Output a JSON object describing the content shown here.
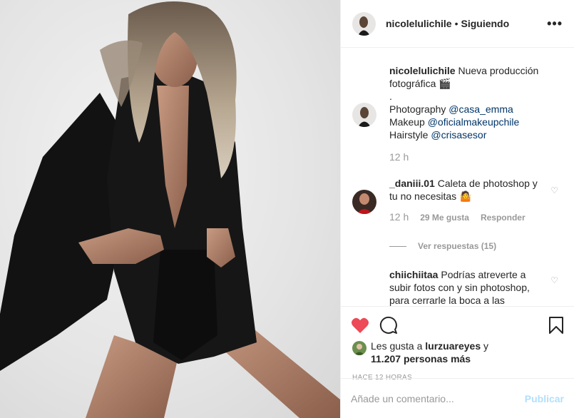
{
  "header": {
    "username": "nicolelulichile",
    "separator": "•",
    "follow_status": "Siguiendo",
    "more_icon": "more-horizontal-icon"
  },
  "comments": [
    {
      "username": "nicolelulichile",
      "text_1": " Nueva producción fotográfica 🎬",
      "text_2": ".",
      "lines": [
        {
          "label": "Photography ",
          "mention": "@casa_emma"
        },
        {
          "label": "Makeup ",
          "mention": "@oficialmakeupchile"
        },
        {
          "label": "Hairstyle ",
          "mention": "@crisasesor"
        }
      ],
      "time": "12 h"
    },
    {
      "username": "_daniii.01",
      "text": " Caleta de photoshop y tu no necesitas 🤷",
      "time": "12 h",
      "likes": "29 Me gusta",
      "reply": "Responder",
      "view_replies": "Ver respuestas (15)"
    },
    {
      "username": "chiichiitaa",
      "text": " Podrías atreverte a subir fotos con y sin photoshop, para cerrarle la boca a las"
    }
  ],
  "actions": {
    "like_icon": "heart-filled-icon",
    "like_color": "#ed4956",
    "comment_icon": "comment-icon",
    "bookmark_icon": "bookmark-icon"
  },
  "likes": {
    "prefix": "Les gusta a ",
    "user": "lurzuareyes",
    "middle": " y ",
    "count": "11.207 personas más"
  },
  "timestamp": "HACE 12 HORAS",
  "add_comment": {
    "placeholder": "Añade un comentario...",
    "publish": "Publicar"
  }
}
